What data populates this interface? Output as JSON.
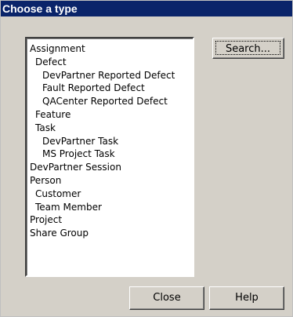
{
  "window": {
    "title": "Choose a type"
  },
  "type_list": {
    "items": [
      {
        "label": "Assignment",
        "level": 0
      },
      {
        "label": "Defect",
        "level": 1
      },
      {
        "label": "DevPartner Reported Defect",
        "level": 2
      },
      {
        "label": "Fault Reported Defect",
        "level": 2
      },
      {
        "label": "QACenter Reported Defect",
        "level": 2
      },
      {
        "label": "Feature",
        "level": 1
      },
      {
        "label": "Task",
        "level": 1
      },
      {
        "label": "DevPartner Task",
        "level": 2
      },
      {
        "label": "MS Project Task",
        "level": 2
      },
      {
        "label": "DevPartner Session",
        "level": 0
      },
      {
        "label": "Person",
        "level": 0
      },
      {
        "label": "Customer",
        "level": 1
      },
      {
        "label": "Team Member",
        "level": 1
      },
      {
        "label": "Project",
        "level": 0
      },
      {
        "label": "Share Group",
        "level": 0
      }
    ]
  },
  "buttons": {
    "search_label": "Search...",
    "close_label": "Close",
    "help_label": "Help"
  },
  "colors": {
    "titlebar": "#0a246a",
    "face": "#d4d0c8",
    "list_background": "#ffffff"
  }
}
